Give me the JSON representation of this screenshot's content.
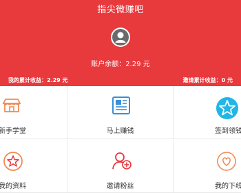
{
  "app": {
    "title": "指尖微赚吧"
  },
  "account": {
    "balance_label": "账户余额：2.29 元"
  },
  "earnings": {
    "my_total": "我的累计收益：2.29 元",
    "invite_total": "邀请累计收益：0 元"
  },
  "menu": {
    "row1": [
      {
        "label": "新手学堂",
        "icon": "storefront-icon"
      },
      {
        "label": "马上赚钱",
        "icon": "newspaper-icon"
      },
      {
        "label": "签到领钱",
        "icon": "star-circle-icon"
      }
    ],
    "row2": [
      {
        "label": "我的资料",
        "icon": "star-outline-icon"
      },
      {
        "label": "邀请粉丝",
        "icon": "add-user-icon"
      },
      {
        "label": "我的下线",
        "icon": "heart-icon"
      }
    ]
  },
  "colors": {
    "brand_red": "#e8393d",
    "icon_orange": "#f28a55",
    "icon_blue": "#3a8fd6",
    "icon_cyan": "#1fb6e8"
  }
}
